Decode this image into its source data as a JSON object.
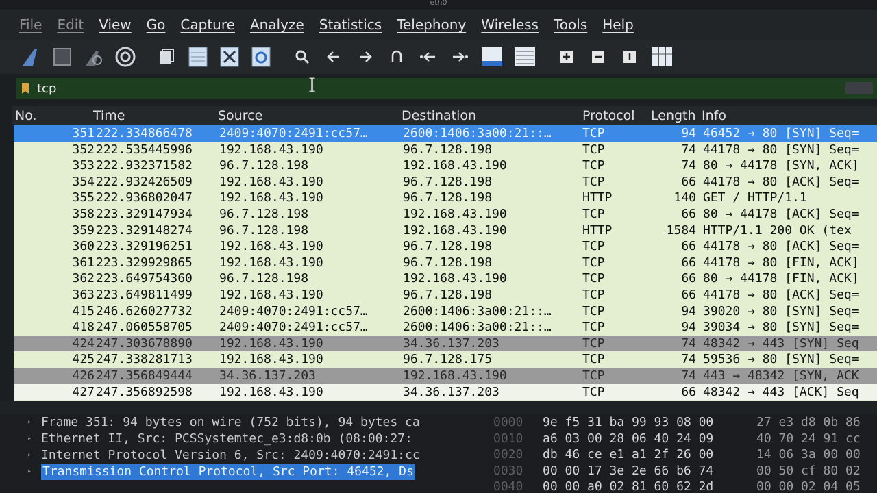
{
  "window": {
    "title": "eth0"
  },
  "menu": [
    "File",
    "Edit",
    "View",
    "Go",
    "Capture",
    "Analyze",
    "Statistics",
    "Telephony",
    "Wireless",
    "Tools",
    "Help"
  ],
  "toolbar_icons": [
    "shark-fin-icon",
    "stop-icon",
    "restart-icon",
    "options-icon",
    "open-file-icon",
    "save-file-icon",
    "close-file-icon",
    "reload-icon",
    "search-icon",
    "back-arrow-icon",
    "forward-arrow-icon",
    "go-to-packet-icon",
    "first-packet-icon",
    "last-packet-icon",
    "autoscroll-icon",
    "colorize-icon",
    "zoom-in-icon",
    "zoom-out-icon",
    "normal-size-icon",
    "resize-columns-icon"
  ],
  "filter": {
    "value": "tcp"
  },
  "columns": {
    "no": "No.",
    "time": "Time",
    "source": "Source",
    "destination": "Destination",
    "protocol": "Protocol",
    "length": "Length",
    "info": "Info"
  },
  "packets": [
    {
      "no": "351",
      "time": "222.334866478",
      "src": "2409:4070:2491:cc57…",
      "dst": "2600:1406:3a00:21::…",
      "proto": "TCP",
      "len": "94",
      "info": "46452 → 80 [SYN] Seq=",
      "style": "sel"
    },
    {
      "no": "352",
      "time": "222.535445996",
      "src": "192.168.43.190",
      "dst": "96.7.128.198",
      "proto": "TCP",
      "len": "74",
      "info": "44178 → 80 [SYN] Seq=",
      "style": ""
    },
    {
      "no": "353",
      "time": "222.932371582",
      "src": "96.7.128.198",
      "dst": "192.168.43.190",
      "proto": "TCP",
      "len": "74",
      "info": "80 → 44178 [SYN, ACK]",
      "style": ""
    },
    {
      "no": "354",
      "time": "222.932426509",
      "src": "192.168.43.190",
      "dst": "96.7.128.198",
      "proto": "TCP",
      "len": "66",
      "info": "44178 → 80 [ACK] Seq=",
      "style": ""
    },
    {
      "no": "355",
      "time": "222.936802047",
      "src": "192.168.43.190",
      "dst": "96.7.128.198",
      "proto": "HTTP",
      "len": "140",
      "info": "GET / HTTP/1.1",
      "style": ""
    },
    {
      "no": "358",
      "time": "223.329147934",
      "src": "96.7.128.198",
      "dst": "192.168.43.190",
      "proto": "TCP",
      "len": "66",
      "info": "80 → 44178 [ACK] Seq=",
      "style": ""
    },
    {
      "no": "359",
      "time": "223.329148274",
      "src": "96.7.128.198",
      "dst": "192.168.43.190",
      "proto": "HTTP",
      "len": "1584",
      "info": "HTTP/1.1 200 OK  (tex",
      "style": ""
    },
    {
      "no": "360",
      "time": "223.329196251",
      "src": "192.168.43.190",
      "dst": "96.7.128.198",
      "proto": "TCP",
      "len": "66",
      "info": "44178 → 80 [ACK] Seq=",
      "style": ""
    },
    {
      "no": "361",
      "time": "223.329929865",
      "src": "192.168.43.190",
      "dst": "96.7.128.198",
      "proto": "TCP",
      "len": "66",
      "info": "44178 → 80 [FIN, ACK]",
      "style": ""
    },
    {
      "no": "362",
      "time": "223.649754360",
      "src": "96.7.128.198",
      "dst": "192.168.43.190",
      "proto": "TCP",
      "len": "66",
      "info": "80 → 44178 [FIN, ACK]",
      "style": ""
    },
    {
      "no": "363",
      "time": "223.649811499",
      "src": "192.168.43.190",
      "dst": "96.7.128.198",
      "proto": "TCP",
      "len": "66",
      "info": "44178 → 80 [ACK] Seq=",
      "style": ""
    },
    {
      "no": "415",
      "time": "246.626027732",
      "src": "2409:4070:2491:cc57…",
      "dst": "2600:1406:3a00:21::…",
      "proto": "TCP",
      "len": "94",
      "info": "39020 → 80 [SYN] Seq=",
      "style": ""
    },
    {
      "no": "418",
      "time": "247.060558705",
      "src": "2409:4070:2491:cc57…",
      "dst": "2600:1406:3a00:21::…",
      "proto": "TCP",
      "len": "94",
      "info": "39034 → 80 [SYN] Seq=",
      "style": ""
    },
    {
      "no": "424",
      "time": "247.303678890",
      "src": "192.168.43.190",
      "dst": "34.36.137.203",
      "proto": "TCP",
      "len": "74",
      "info": "48342 → 443 [SYN] Seq",
      "style": "gray"
    },
    {
      "no": "425",
      "time": "247.338281713",
      "src": "192.168.43.190",
      "dst": "96.7.128.175",
      "proto": "TCP",
      "len": "74",
      "info": "59536 → 80 [SYN] Seq=",
      "style": ""
    },
    {
      "no": "426",
      "time": "247.356849444",
      "src": "34.36.137.203",
      "dst": "192.168.43.190",
      "proto": "TCP",
      "len": "74",
      "info": "443 → 48342 [SYN, ACK",
      "style": "gray"
    },
    {
      "no": "427",
      "time": "247.356892598",
      "src": "192.168.43.190",
      "dst": "34.36.137.203",
      "proto": "TCP",
      "len": "66",
      "info": "48342 → 443 [ACK] Seq",
      "style": "light"
    }
  ],
  "details": [
    {
      "text": "Frame 351: 94 bytes on wire (752 bits), 94 bytes ca",
      "hl": false
    },
    {
      "text": "Ethernet II, Src: PCSSystemtec_e3:d8:0b (08:00:27:",
      "hl": false
    },
    {
      "text": "Internet Protocol Version 6, Src: 2409:4070:2491:cc",
      "hl": false
    },
    {
      "text": "Transmission Control Protocol, Src Port: 46452, Ds",
      "hl": true
    }
  ],
  "bytes": [
    {
      "off": "0000",
      "hex1": "9e f5 31 ba 99 93 08 00",
      "hex2": "27 e3 d8 0b 86"
    },
    {
      "off": "0010",
      "hex1": "a6 03 00 28 06 40 24 09",
      "hex2": "40 70 24 91 cc"
    },
    {
      "off": "0020",
      "hex1": "db 46 ce e1 a1 2f 26 00",
      "hex2": "14 06 3a 00 00"
    },
    {
      "off": "0030",
      "hex1": "00 00 17 3e 2e 66 b6 74",
      "hex2": "00 50 cf 80 02"
    },
    {
      "off": "0040",
      "hex1": "00 00 a0 02 81 60 62 2d",
      "hex2": "00 00 02 04 05"
    }
  ]
}
